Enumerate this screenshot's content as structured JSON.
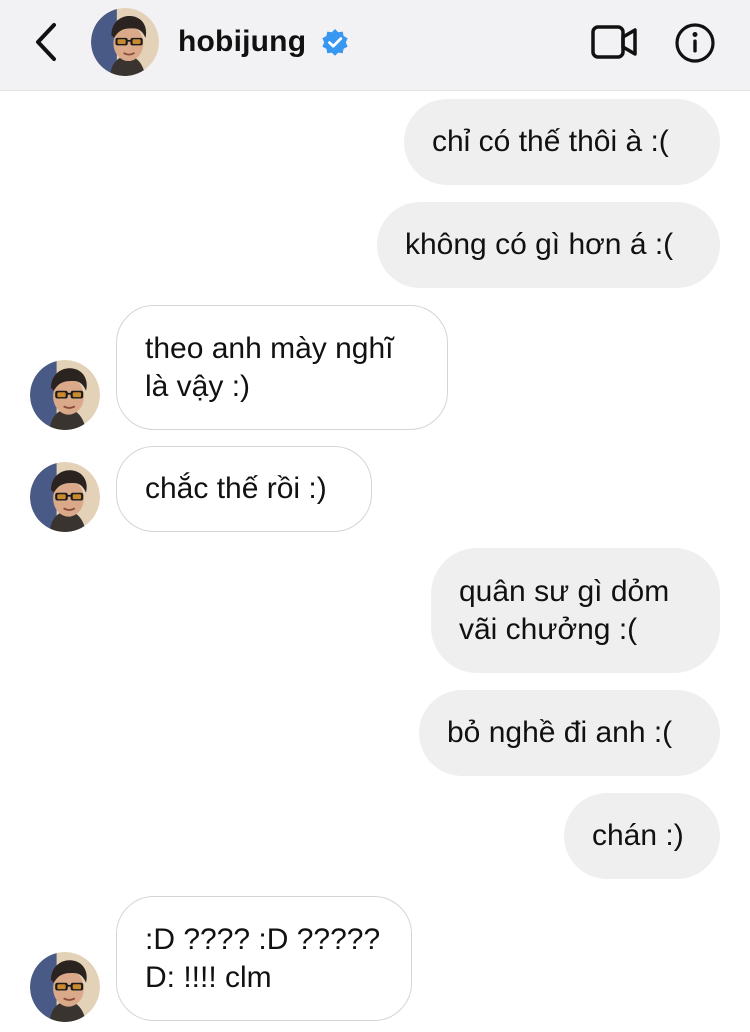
{
  "header": {
    "username": "hobijung",
    "icons": {
      "back": "chevron-left-icon",
      "verified": "verified-badge-icon",
      "video": "video-camera-icon",
      "info": "info-icon"
    }
  },
  "colors": {
    "header_bg": "#f2f2f4",
    "outgoing_bubble": "#efefef",
    "incoming_border": "#d5d5d8",
    "verified_blue": "#3897f0"
  },
  "messages": [
    {
      "direction": "outgoing",
      "text": "chỉ có thế thôi à :("
    },
    {
      "direction": "outgoing",
      "text": "không có gì hơn á :("
    },
    {
      "direction": "incoming",
      "text": "theo anh mày nghĩ\nlà vậy :)"
    },
    {
      "direction": "incoming",
      "text": "chắc thế rồi :)"
    },
    {
      "direction": "outgoing",
      "text": "quân sư gì dỏm\nvãi chưởng :("
    },
    {
      "direction": "outgoing",
      "text": "bỏ nghề đi anh :("
    },
    {
      "direction": "outgoing",
      "text": "chán :)"
    },
    {
      "direction": "incoming",
      "text": ":D ???? :D ?????\nD: !!!! clm"
    }
  ]
}
